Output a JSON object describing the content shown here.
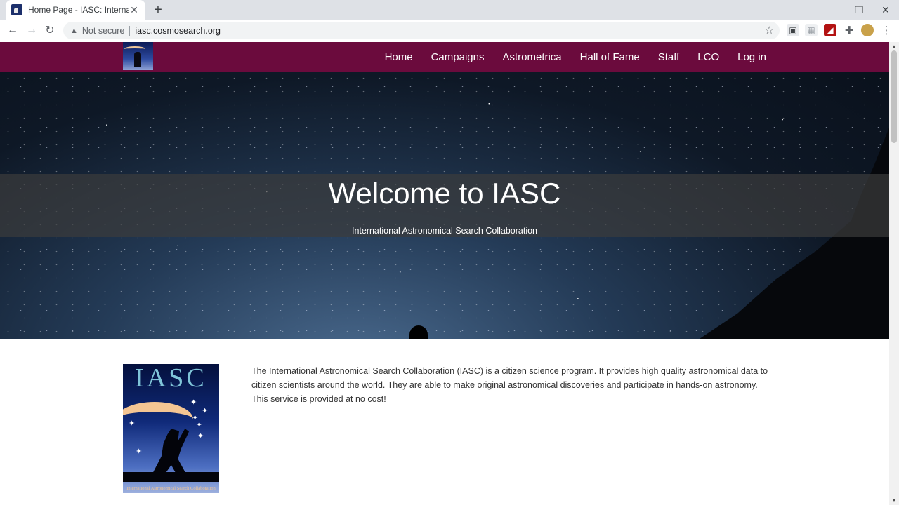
{
  "browser": {
    "tab": {
      "title": "Home Page - IASC: International",
      "close": "✕"
    },
    "new_tab": "+",
    "window_controls": {
      "minimize": "—",
      "restore": "❐",
      "close": "✕"
    },
    "nav": {
      "back": "←",
      "forward": "→",
      "reload": "↻"
    },
    "security": {
      "icon": "warning-triangle-icon",
      "label": "Not secure"
    },
    "url": "iasc.cosmosearch.org",
    "bookmark_icon": "☆"
  },
  "site": {
    "brand_colors": {
      "navbar": "#6b0b3d"
    },
    "nav_links": [
      "Home",
      "Campaigns",
      "Astrometrica",
      "Hall of Fame",
      "Staff",
      "LCO",
      "Log in"
    ],
    "hero": {
      "title": "Welcome to IASC",
      "subtitle": "International Astronomical Search Collaboration"
    },
    "about": {
      "logo_text": "IASC",
      "logo_caption": "International Astronomical Search Collaboration",
      "text": "The International Astronomical Search Collaboration (IASC) is a citizen science program. It provides high quality astronomical data to citizen scientists around the world. They are able to make original astronomical discoveries and participate in hands-on astronomy. This service is provided at no cost!"
    }
  }
}
